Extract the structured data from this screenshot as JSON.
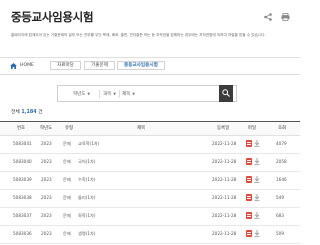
{
  "page": {
    "title": "중등교사임용시험",
    "notice": "홈페이지에 탑재되어 있는 기출문제의 일부 또는 전부를 무단 복제, 배포, 출판, 전자출판 하는 등 저작권을 침해하는 경우에는 저작권법에 의하여 처벌을 받을 수 있습니다."
  },
  "breadcrumb": {
    "home": "HOME",
    "level1": "자료마당",
    "level2": "기출문제",
    "current": "중등교사임용시험"
  },
  "search": {
    "year_select": "학년도",
    "subject_select": "과목",
    "field_select": "제목",
    "query": ""
  },
  "list": {
    "total_label": "전체",
    "total_count": "1,184",
    "total_unit": "건",
    "headers": [
      "번호",
      "학년도",
      "유형",
      "제목",
      "등록일",
      "파일",
      "조회"
    ],
    "rows": [
      {
        "no": "5083041",
        "year": "2023",
        "type": "문제",
        "title": "교육학(1차)",
        "date": "2022-11-28",
        "views": "4079"
      },
      {
        "no": "5083040",
        "year": "2023",
        "type": "문제",
        "title": "국어(1차)",
        "date": "2022-11-28",
        "views": "2058"
      },
      {
        "no": "5083039",
        "year": "2023",
        "type": "문제",
        "title": "수학(1차)",
        "date": "2022-11-28",
        "views": "1646"
      },
      {
        "no": "5083038",
        "year": "2023",
        "type": "문제",
        "title": "물리(1차)",
        "date": "2022-11-28",
        "views": "549"
      },
      {
        "no": "5083037",
        "year": "2023",
        "type": "문제",
        "title": "화학(1차)",
        "date": "2022-11-28",
        "views": "683"
      },
      {
        "no": "5083036",
        "year": "2023",
        "type": "문제",
        "title": "생명(1차)",
        "date": "2022-11-28",
        "views": "509"
      }
    ]
  },
  "colors": {
    "accent": "#2b6cb0",
    "file_icon": "#e04a3c",
    "search_button": "#3c3c3c"
  }
}
